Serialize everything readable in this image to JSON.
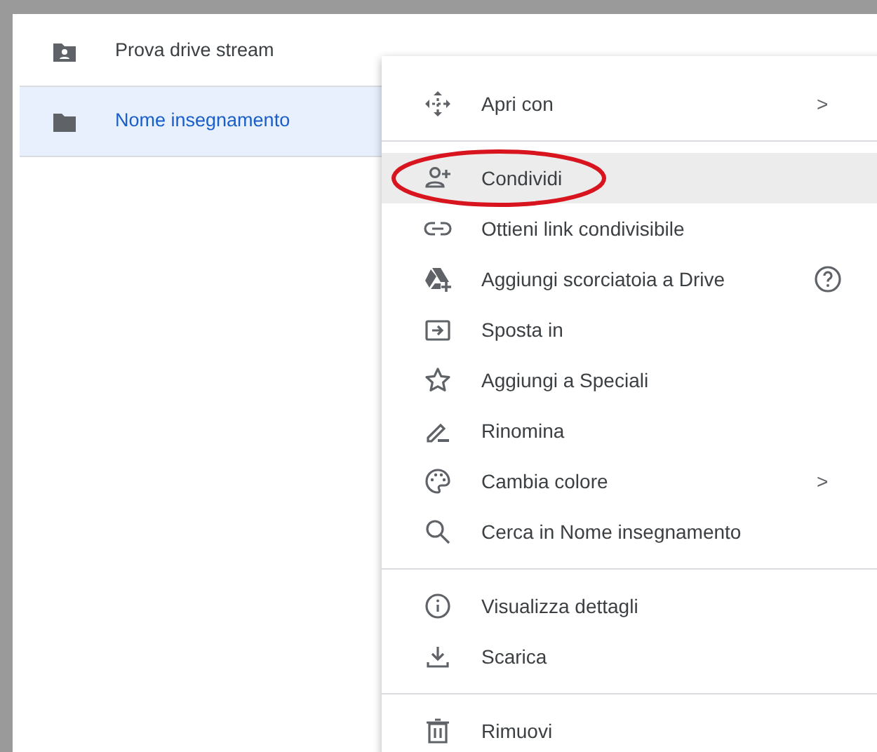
{
  "files": [
    {
      "name": "Prova drive stream",
      "kind": "shared-folder",
      "selected": false
    },
    {
      "name": "Nome insegnamento",
      "kind": "folder",
      "selected": true
    }
  ],
  "context_menu": {
    "groups": [
      [
        {
          "label": "Apri con",
          "submenu_arrow": ">",
          "highlighted": false
        }
      ],
      [
        {
          "label": "Condividi",
          "highlighted": true,
          "circled": true
        },
        {
          "label": "Ottieni link condivisibile",
          "highlighted": false
        },
        {
          "label": "Aggiungi scorciatoia a Drive",
          "highlighted": false,
          "help": true
        },
        {
          "label": "Sposta in",
          "highlighted": false
        },
        {
          "label": "Aggiungi a Speciali",
          "highlighted": false
        },
        {
          "label": "Rinomina",
          "highlighted": false
        },
        {
          "label": "Cambia colore",
          "submenu_arrow": ">",
          "highlighted": false
        },
        {
          "label": "Cerca in Nome insegnamento",
          "highlighted": false
        }
      ],
      [
        {
          "label": "Visualizza dettagli",
          "highlighted": false
        },
        {
          "label": "Scarica",
          "highlighted": false
        }
      ],
      [
        {
          "label": "Rimuovi",
          "highlighted": false
        }
      ]
    ]
  }
}
